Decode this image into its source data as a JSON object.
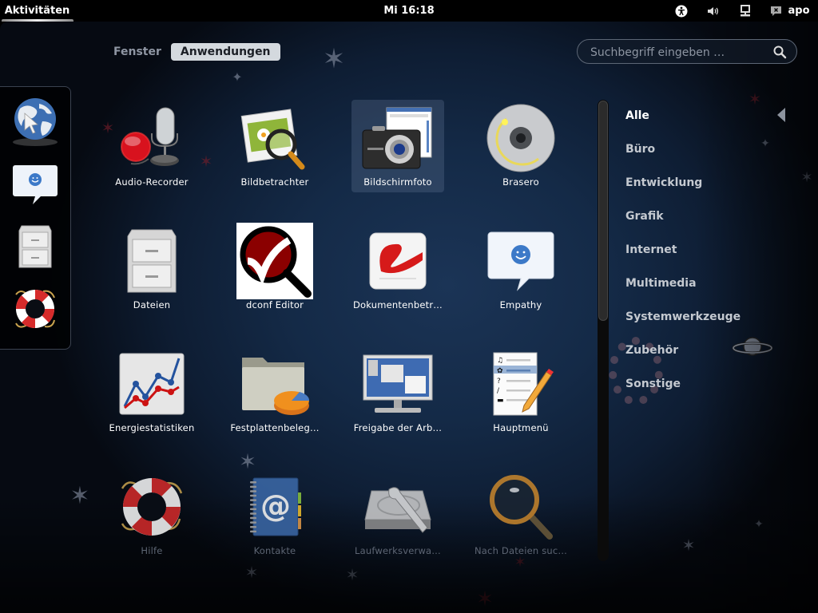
{
  "topbar": {
    "activities_label": "Aktivitäten",
    "clock": "Mi 16:18",
    "tray": {
      "accessibility_icon": "accessibility-icon",
      "volume_icon": "volume-icon",
      "network_icon": "network-wired-icon",
      "user_status_icon": "user-offline-icon",
      "user_name": "apo"
    }
  },
  "view_switch": {
    "windows_label": "Fenster",
    "applications_label": "Anwendungen",
    "active": "Anwendungen"
  },
  "search": {
    "value": "",
    "placeholder": "Suchbegriff eingeben …"
  },
  "dash": {
    "items": [
      {
        "name": "Web-Browser",
        "icon": "web-browser-icon"
      },
      {
        "name": "Empathy",
        "icon": "empathy-icon"
      },
      {
        "name": "Dateien",
        "icon": "file-cabinet-icon"
      },
      {
        "name": "Hilfe",
        "icon": "help-lifebuoy-icon"
      }
    ]
  },
  "apps": [
    {
      "label": "Audio-Recorder",
      "icon": "audio-recorder-icon",
      "selected": false,
      "dim": false
    },
    {
      "label": "Bildbetrachter",
      "icon": "image-viewer-icon",
      "selected": false,
      "dim": false
    },
    {
      "label": "Bildschirmfoto",
      "icon": "screenshot-icon",
      "selected": true,
      "dim": false
    },
    {
      "label": "Brasero",
      "icon": "brasero-disc-icon",
      "selected": false,
      "dim": false
    },
    {
      "label": "Dateien",
      "icon": "file-cabinet-icon",
      "selected": false,
      "dim": false
    },
    {
      "label": "dconf Editor",
      "icon": "dconf-editor-icon",
      "selected": false,
      "dim": false
    },
    {
      "label": "Dokumentenbetr…",
      "icon": "document-viewer-icon",
      "selected": false,
      "dim": false
    },
    {
      "label": "Empathy",
      "icon": "empathy-icon",
      "selected": false,
      "dim": false
    },
    {
      "label": "Energiestatistiken",
      "icon": "power-statistics-icon",
      "selected": false,
      "dim": false
    },
    {
      "label": "Festplattenbeleg…",
      "icon": "disk-usage-icon",
      "selected": false,
      "dim": false
    },
    {
      "label": "Freigabe der Arb…",
      "icon": "desktop-sharing-icon",
      "selected": false,
      "dim": false
    },
    {
      "label": "Hauptmenü",
      "icon": "main-menu-editor-icon",
      "selected": false,
      "dim": false
    },
    {
      "label": "Hilfe",
      "icon": "help-lifebuoy-icon",
      "selected": false,
      "dim": true
    },
    {
      "label": "Kontakte",
      "icon": "contacts-addressbook-icon",
      "selected": false,
      "dim": true
    },
    {
      "label": "Laufwerksverwa…",
      "icon": "disk-utility-icon",
      "selected": false,
      "dim": true
    },
    {
      "label": "Nach Dateien suc…",
      "icon": "search-files-magnifier-icon",
      "selected": false,
      "dim": true
    }
  ],
  "scroll": {
    "position_fraction": 0.0,
    "visible_fraction": 0.48
  },
  "categories": {
    "active": "Alle",
    "items": [
      "Alle",
      "Büro",
      "Entwicklung",
      "Grafik",
      "Internet",
      "Multimedia",
      "Systemwerkzeuge",
      "Zubehör",
      "Sonstige"
    ]
  }
}
